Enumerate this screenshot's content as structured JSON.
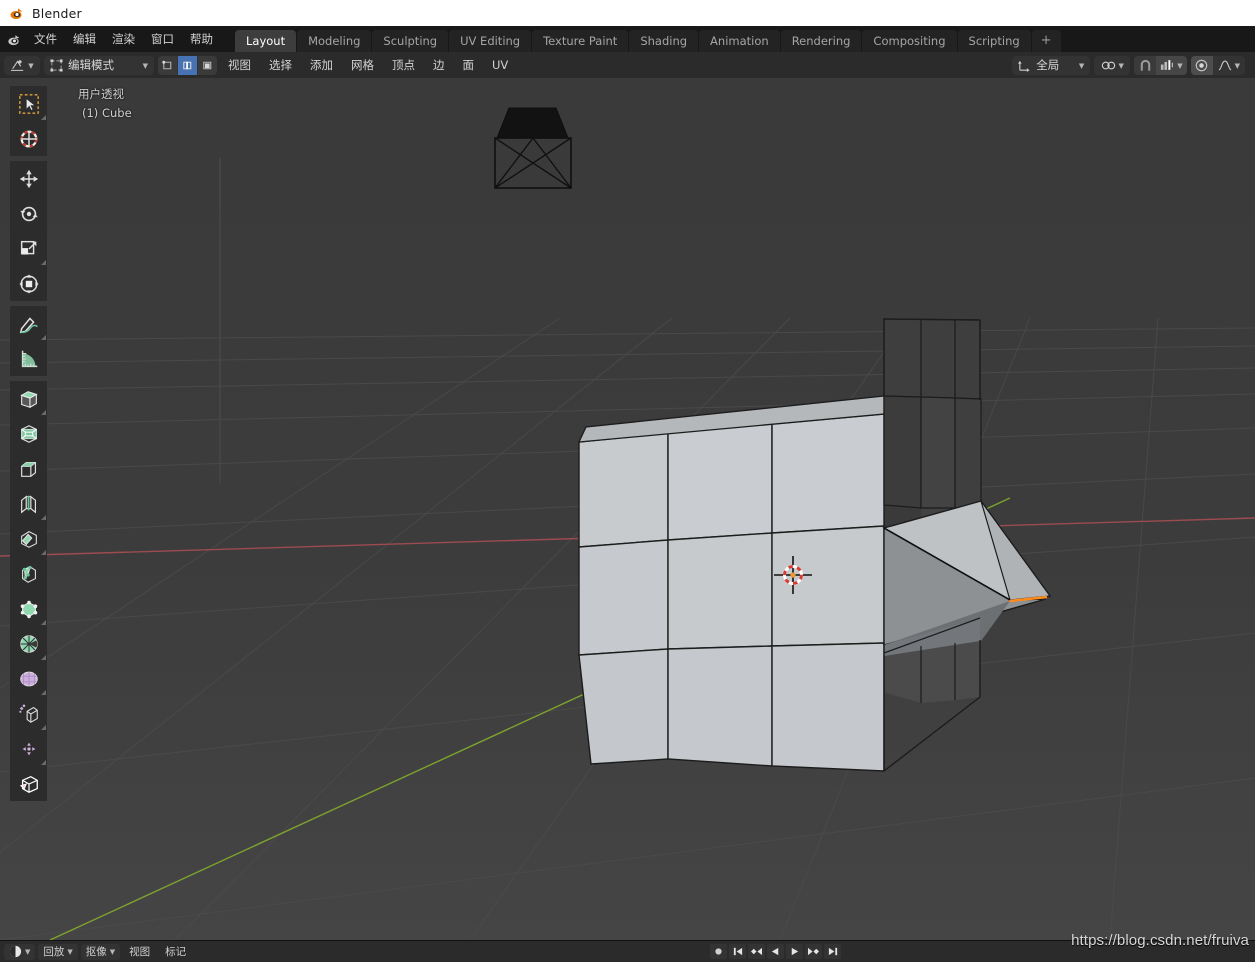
{
  "window": {
    "title": "Blender",
    "app_icon": "blender-logo-icon"
  },
  "topbar": {
    "logo_icon": "blender-logo-icon",
    "menus": [
      {
        "label": "文件",
        "name": "menu-file"
      },
      {
        "label": "编辑",
        "name": "menu-edit"
      },
      {
        "label": "渲染",
        "name": "menu-render"
      },
      {
        "label": "窗口",
        "name": "menu-window"
      },
      {
        "label": "帮助",
        "name": "menu-help"
      }
    ],
    "workspace_tabs": [
      {
        "label": "Layout",
        "active": true
      },
      {
        "label": "Modeling",
        "active": false
      },
      {
        "label": "Sculpting",
        "active": false
      },
      {
        "label": "UV Editing",
        "active": false
      },
      {
        "label": "Texture Paint",
        "active": false
      },
      {
        "label": "Shading",
        "active": false
      },
      {
        "label": "Animation",
        "active": false
      },
      {
        "label": "Rendering",
        "active": false
      },
      {
        "label": "Compositing",
        "active": false
      },
      {
        "label": "Scripting",
        "active": false
      }
    ],
    "add_tab_label": "+"
  },
  "viewport_header": {
    "editor_type_icon": "editor-type-icon",
    "mode_value": "编辑模式",
    "select_mode": {
      "vertex_icon": "vertex-select-icon",
      "edge_icon": "edge-select-icon",
      "face_icon": "face-select-icon",
      "active": "edge"
    },
    "menus": [
      {
        "label": "视图",
        "name": "vp-menu-view"
      },
      {
        "label": "选择",
        "name": "vp-menu-select"
      },
      {
        "label": "添加",
        "name": "vp-menu-add"
      },
      {
        "label": "网格",
        "name": "vp-menu-mesh"
      },
      {
        "label": "顶点",
        "name": "vp-menu-vertex"
      },
      {
        "label": "边",
        "name": "vp-menu-edge"
      },
      {
        "label": "面",
        "name": "vp-menu-face"
      },
      {
        "label": "UV",
        "name": "vp-menu-uv"
      }
    ],
    "transform_orientation": {
      "icon": "orientation-axis-icon",
      "value": "全局"
    },
    "snap": {
      "icon": "magnet-icon",
      "enabled": false
    },
    "proportional_edit": {
      "icon": "proportional-edit-icon",
      "enabled": true
    },
    "proportional_falloff": {
      "icon": "smooth-falloff-icon"
    },
    "snap_target": {
      "icon": "snap-target-icon"
    }
  },
  "toolbar": {
    "tools": [
      {
        "name": "tweak-tool",
        "icon": "cursor-arrow-icon",
        "selected": false,
        "has_submenu": true,
        "gap": false
      },
      {
        "name": "cursor-tool",
        "icon": "3d-cursor-icon",
        "selected": false,
        "has_submenu": false,
        "gap": false
      },
      {
        "name": "move-tool",
        "icon": "move-arrows-icon",
        "selected": false,
        "has_submenu": false,
        "gap": true
      },
      {
        "name": "rotate-tool",
        "icon": "rotate-icon",
        "selected": false,
        "has_submenu": false,
        "gap": false
      },
      {
        "name": "scale-tool",
        "icon": "scale-icon",
        "selected": false,
        "has_submenu": true,
        "gap": false
      },
      {
        "name": "transform-tool",
        "icon": "transform-icon",
        "selected": false,
        "has_submenu": false,
        "gap": false
      },
      {
        "name": "annotate-tool",
        "icon": "annotate-pencil-icon",
        "selected": false,
        "has_submenu": true,
        "gap": true
      },
      {
        "name": "measure-tool",
        "icon": "measure-ruler-icon",
        "selected": false,
        "has_submenu": false,
        "gap": false
      },
      {
        "name": "extrude-region-tool",
        "icon": "extrude-region-icon",
        "selected": false,
        "has_submenu": true,
        "gap": true
      },
      {
        "name": "inset-faces-tool",
        "icon": "inset-faces-icon",
        "selected": false,
        "has_submenu": false,
        "gap": false
      },
      {
        "name": "bevel-tool",
        "icon": "bevel-icon",
        "selected": false,
        "has_submenu": false,
        "gap": false
      },
      {
        "name": "loop-cut-tool",
        "icon": "loop-cut-icon",
        "selected": false,
        "has_submenu": true,
        "gap": false
      },
      {
        "name": "knife-tool",
        "icon": "knife-icon",
        "selected": false,
        "has_submenu": true,
        "gap": false
      },
      {
        "name": "poly-build-tool",
        "icon": "poly-build-icon",
        "selected": false,
        "has_submenu": false,
        "gap": false
      },
      {
        "name": "spin-tool",
        "icon": "spin-icon",
        "selected": false,
        "has_submenu": true,
        "gap": false
      },
      {
        "name": "smooth-tool",
        "icon": "smooth-icon",
        "selected": false,
        "has_submenu": true,
        "gap": false
      },
      {
        "name": "shrink-fatten-tool",
        "icon": "shrink-fatten-icon",
        "selected": false,
        "has_submenu": true,
        "gap": false
      },
      {
        "name": "edge-slide-tool",
        "icon": "edge-slide-icon",
        "selected": false,
        "has_submenu": true,
        "gap": false
      },
      {
        "name": "shear-tool",
        "icon": "shear-icon",
        "selected": false,
        "has_submenu": true,
        "gap": false
      },
      {
        "name": "rip-region-tool",
        "icon": "rip-region-icon",
        "selected": true,
        "has_submenu": true,
        "gap": false
      }
    ]
  },
  "viewport": {
    "view_name": "用户透视",
    "object_name": "(1) Cube",
    "background_color": "#393939",
    "grid_color": "#4a4a4a",
    "x_axis_color": "#9a4a4f",
    "y_axis_color": "#7a9a33",
    "selected_edge_color": "#ff8b1e",
    "mesh_face_color": "#c7cacd",
    "cursor_icon": "3d-cursor-icon",
    "camera_icon": "camera-wireframe-icon"
  },
  "timeline": {
    "editor_icon": "timeline-editor-icon",
    "menus": [
      {
        "label": "回放",
        "name": "tl-menu-playback",
        "has_chevron": true
      },
      {
        "label": "抠像",
        "name": "tl-menu-keying",
        "has_chevron": true
      },
      {
        "label": "视图",
        "name": "tl-menu-view",
        "has_chevron": false
      },
      {
        "label": "标记",
        "name": "tl-menu-marker",
        "has_chevron": false
      }
    ],
    "transport": [
      {
        "name": "record-button",
        "icon": "record-icon"
      },
      {
        "name": "jump-start-button",
        "icon": "jump-to-start-icon"
      },
      {
        "name": "prev-keyframe-button",
        "icon": "prev-keyframe-icon"
      },
      {
        "name": "play-reverse-button",
        "icon": "play-reverse-icon"
      },
      {
        "name": "play-button",
        "icon": "play-icon"
      },
      {
        "name": "next-keyframe-button",
        "icon": "next-keyframe-icon"
      },
      {
        "name": "jump-end-button",
        "icon": "jump-to-end-icon"
      }
    ]
  },
  "watermark": {
    "text": "https://blog.csdn.net/fruiva"
  }
}
